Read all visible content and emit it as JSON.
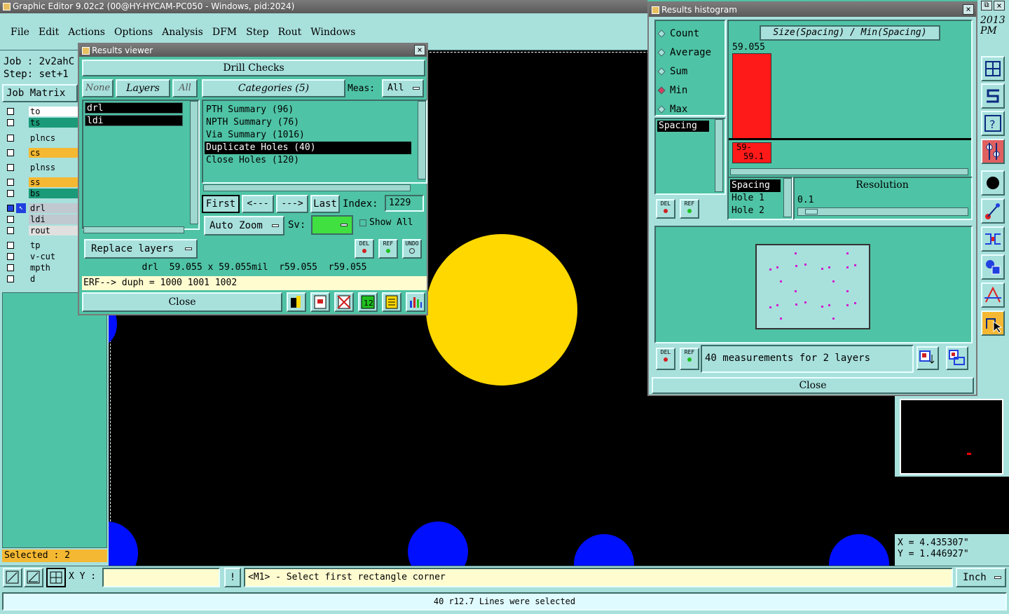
{
  "app": {
    "title": "Graphic Editor 9.02c2 (00@HY-HYCAM-PC050 - Windows, pid:2024)",
    "menu": [
      "File",
      "Edit",
      "Actions",
      "Options",
      "Analysis",
      "DFM",
      "Step",
      "Rout",
      "Windows"
    ]
  },
  "left_panel": {
    "job": "Job : 2v2ahC",
    "step": "Step: set+1",
    "job_matrix": "Job Matrix",
    "layers": [
      {
        "name": "to",
        "color": "#ffffff"
      },
      {
        "name": "ts",
        "color": "#1a9a78"
      },
      {
        "name": "plncs",
        "color": "#a8e0dc"
      },
      {
        "name": "cs",
        "color": "#f5b832"
      },
      {
        "name": "plnss",
        "color": "#a8e0dc"
      },
      {
        "name": "ss",
        "color": "#f5b832"
      },
      {
        "name": "bs",
        "color": "#1a9a78"
      },
      {
        "name": "drl",
        "color": "#c0c8d0"
      },
      {
        "name": "ldi",
        "color": "#c0c8d0"
      },
      {
        "name": "rout",
        "color": "#e0e0e0"
      },
      {
        "name": "tp",
        "color": "#a8e0dc"
      },
      {
        "name": "v-cut",
        "color": "#a8e0dc"
      },
      {
        "name": "mpth",
        "color": "#a8e0dc"
      },
      {
        "name": "d",
        "color": "#a8e0dc"
      }
    ],
    "selected": "Selected : 2"
  },
  "results_viewer": {
    "title": "Results viewer",
    "header": "Drill Checks",
    "none_label": "None",
    "layers_label": "Layers",
    "all_label": "All",
    "categories_label": "Categories (5)",
    "meas_label": "Meas:",
    "meas_value": "All",
    "layer_items": [
      "drl",
      "ldi"
    ],
    "categories": [
      "PTH Summary (96)",
      "NPTH Summary (76)",
      "Via Summary (1016)",
      "Duplicate Holes (40)",
      "Close Holes (120)"
    ],
    "selected_category_index": 3,
    "first": "First",
    "prev": "<---",
    "next": "--->",
    "last": "Last",
    "index_label": "Index:",
    "index_value": "1229",
    "auto_zoom": "Auto Zoom",
    "sv_label": "Sv:",
    "show_all": "Show All",
    "replace_layers": "Replace layers",
    "del": "DEL",
    "ref": "REF",
    "undo": "UNDO",
    "info_line": "drl  59.055 x 59.055mil  r59.055  r59.055",
    "erf_line": "ERF--> duph = 1000 1001 1002",
    "close": "Close"
  },
  "histogram": {
    "title": "Results histogram",
    "modes": [
      "Count",
      "Average",
      "Sum",
      "Min",
      "Max"
    ],
    "selected_mode": "Min",
    "chart_title": "Size(Spacing) / Min(Spacing)",
    "bar_value": "59.055",
    "bar_label_line1": "59-",
    "bar_label_line2": "59.1",
    "spacing_label": "Spacing",
    "fields": [
      "Spacing",
      "Hole 1",
      "Hole 2"
    ],
    "resolution_label": "Resolution",
    "resolution_value": "0.1",
    "measurements": "40 measurements for 2 layers",
    "close": "Close",
    "del": "DEL",
    "ref": "REF"
  },
  "clock": {
    "line1": "2013",
    "line2": "PM"
  },
  "coords": {
    "x": "X = 4.435307\"",
    "y": "Y = 1.446927\""
  },
  "bottom": {
    "xy_label": "X Y :",
    "prompt": "<M1> - Select first rectangle corner",
    "units": "Inch",
    "status": "40 r12.7 Lines were selected",
    "excl": "!"
  }
}
